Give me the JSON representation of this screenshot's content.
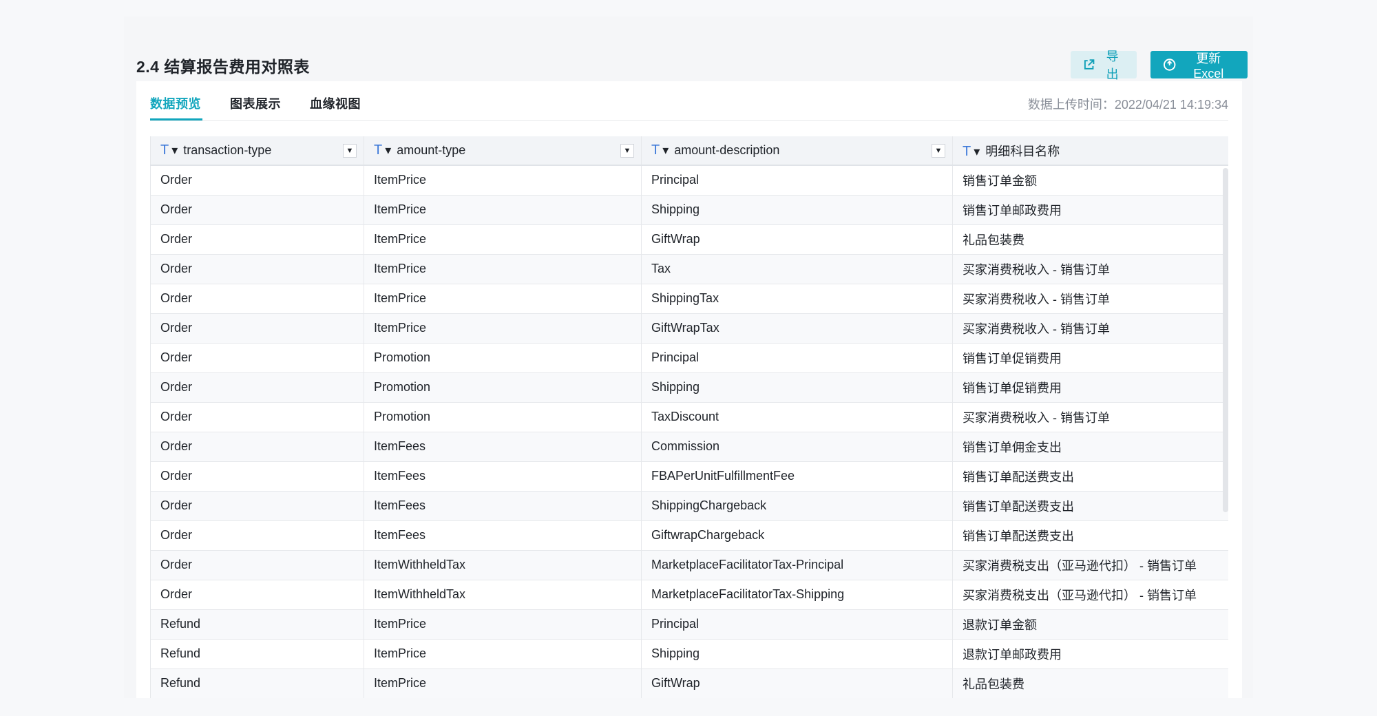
{
  "header": {
    "title": "2.4 结算报告费用对照表",
    "export_label": "导出",
    "update_label": "更新Excel"
  },
  "tabs": [
    {
      "label": "数据预览",
      "active": true
    },
    {
      "label": "图表展示",
      "active": false
    },
    {
      "label": "血缘视图",
      "active": false
    }
  ],
  "upload_time": "数据上传时间：2022/04/21 14:19:34",
  "table": {
    "type_icon": "T",
    "columns": [
      {
        "label": "transaction-type",
        "filter": true
      },
      {
        "label": "amount-type",
        "filter": true
      },
      {
        "label": "amount-description",
        "filter": true
      },
      {
        "label": "明细科目名称",
        "filter": false
      }
    ],
    "rows": [
      [
        "Order",
        "ItemPrice",
        "Principal",
        "销售订单金额"
      ],
      [
        "Order",
        "ItemPrice",
        "Shipping",
        "销售订单邮政费用"
      ],
      [
        "Order",
        "ItemPrice",
        "GiftWrap",
        "礼品包装费"
      ],
      [
        "Order",
        "ItemPrice",
        "Tax",
        "买家消费税收入 - 销售订单"
      ],
      [
        "Order",
        "ItemPrice",
        "ShippingTax",
        "买家消费税收入 - 销售订单"
      ],
      [
        "Order",
        "ItemPrice",
        "GiftWrapTax",
        "买家消费税收入 - 销售订单"
      ],
      [
        "Order",
        "Promotion",
        "Principal",
        "销售订单促销费用"
      ],
      [
        "Order",
        "Promotion",
        "Shipping",
        "销售订单促销费用"
      ],
      [
        "Order",
        "Promotion",
        "TaxDiscount",
        "买家消费税收入 - 销售订单"
      ],
      [
        "Order",
        "ItemFees",
        "Commission",
        "销售订单佣金支出"
      ],
      [
        "Order",
        "ItemFees",
        "FBAPerUnitFulfillmentFee",
        "销售订单配送费支出"
      ],
      [
        "Order",
        "ItemFees",
        "ShippingChargeback",
        "销售订单配送费支出"
      ],
      [
        "Order",
        "ItemFees",
        "GiftwrapChargeback",
        "销售订单配送费支出"
      ],
      [
        "Order",
        "ItemWithheldTax",
        "MarketplaceFacilitatorTax-Principal",
        "买家消费税支出（亚马逊代扣） - 销售订单"
      ],
      [
        "Order",
        "ItemWithheldTax",
        "MarketplaceFacilitatorTax-Shipping",
        "买家消费税支出（亚马逊代扣） - 销售订单"
      ],
      [
        "Refund",
        "ItemPrice",
        "Principal",
        "退款订单金额"
      ],
      [
        "Refund",
        "ItemPrice",
        "Shipping",
        "退款订单邮政费用"
      ],
      [
        "Refund",
        "ItemPrice",
        "GiftWrap",
        "礼品包装费"
      ]
    ]
  },
  "colors": {
    "accent": "#12a6bd",
    "accent_light": "#dceff3",
    "type_icon": "#3d79d9"
  }
}
